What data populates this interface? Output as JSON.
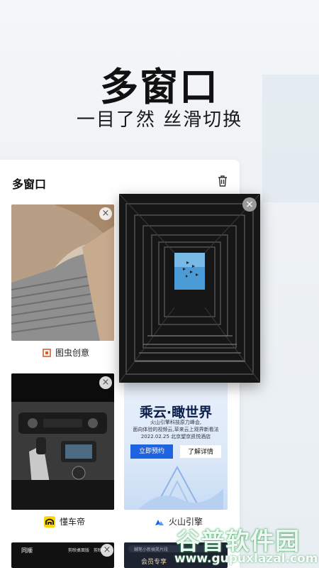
{
  "hero": {
    "title": "多窗口",
    "subtitle": "一目了然 丝滑切换"
  },
  "panel": {
    "title": "多窗口",
    "trash_icon": "trash-icon"
  },
  "cards": [
    {
      "label": "图虫创意",
      "icon": "tuchong-icon"
    },
    {
      "label": "懂车帝",
      "icon": "dongchedi-icon"
    },
    {
      "label": "火山引擎",
      "icon": "volcano-engine-icon"
    }
  ],
  "ad": {
    "title": "乘云·瞰世界",
    "line1": "火山引擎科技原力峰会,",
    "line2": "面向体验的视频云,草来云上观界新看法",
    "line3": "2022.02.25 北京望京凯悦酒店",
    "btn_primary": "立即预约",
    "btn_secondary": "了解详情"
  },
  "bottom_cards": {
    "left_brand": "同顺",
    "left_text1": "剪映桌面版",
    "left_text2": "剪映专业",
    "right_search": "輔笔小新搞笑片段",
    "right_text": "会员专享"
  },
  "close_symbol": "×",
  "watermark": {
    "big": "谷普软件园",
    "small": "www.gupuxlazal.com"
  },
  "colors": {
    "accent_blue": "#1e63e0",
    "dongchedi_yellow": "#ffd400"
  }
}
